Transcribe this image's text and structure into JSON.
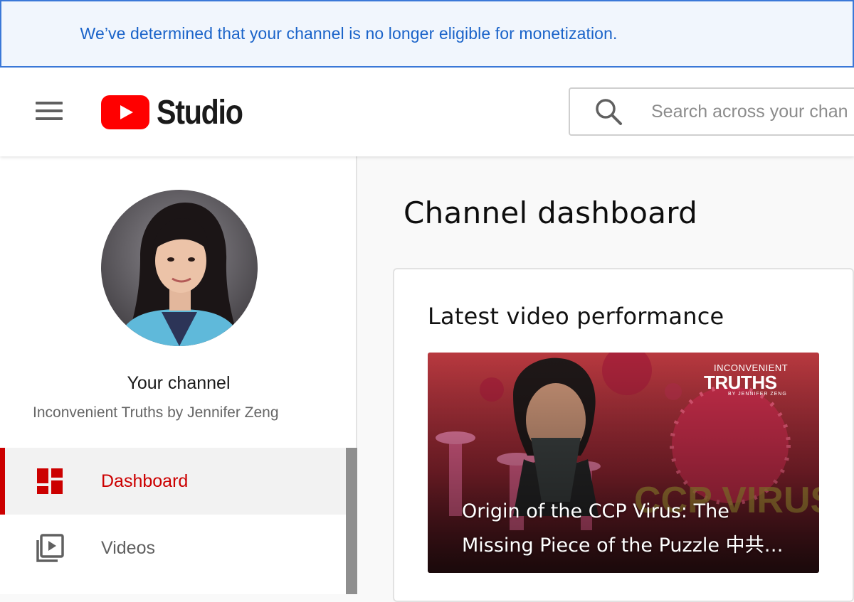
{
  "banner": {
    "message": "We’ve determined that your channel is no longer eligible for monetization."
  },
  "header": {
    "logo_text": "Studio",
    "search_placeholder": "Search across your chan"
  },
  "sidebar": {
    "channel_label": "Your channel",
    "channel_name": "Inconvenient Truths by Jennifer Zeng",
    "items": [
      {
        "label": "Dashboard",
        "icon": "dashboard-icon",
        "active": true
      },
      {
        "label": "Videos",
        "icon": "video-library-icon",
        "active": false
      }
    ]
  },
  "main": {
    "page_title": "Channel dashboard",
    "card": {
      "title": "Latest video performance",
      "video_title": "Origin of the CCP Virus: The Missing Piece of the Puzzle 中共…",
      "thumbnail_brand_top": "INCONVENIENT",
      "thumbnail_brand_main": "TRUTHS",
      "thumbnail_brand_sub": "BY JENNIFER ZENG"
    }
  },
  "colors": {
    "accent_red": "#cc0000",
    "banner_blue": "#1a63c9",
    "banner_bg": "#f1f6fd"
  }
}
